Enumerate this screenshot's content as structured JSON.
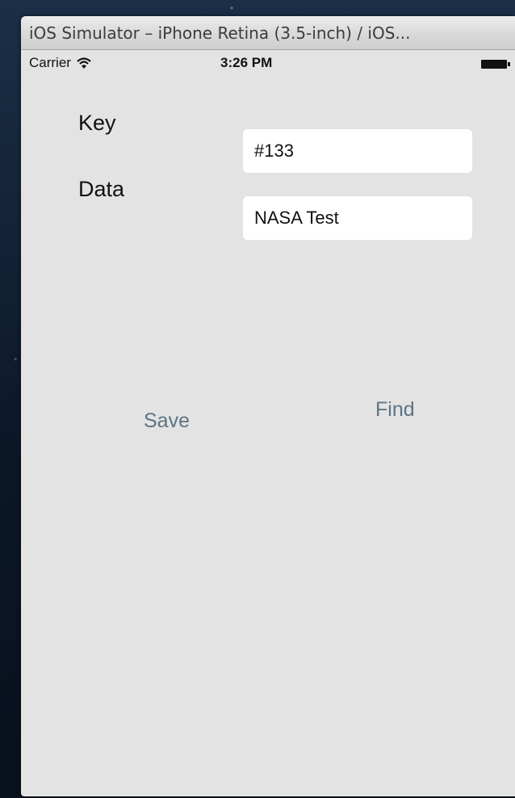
{
  "window": {
    "title": "iOS Simulator – iPhone Retina (3.5-inch) / iOS..."
  },
  "status_bar": {
    "carrier": "Carrier",
    "time": "3:26 PM",
    "icons": [
      "wifi-icon",
      "battery-icon"
    ]
  },
  "form": {
    "key_label": "Key",
    "key_value": "#133",
    "data_label": "Data",
    "data_value": "NASA Test"
  },
  "buttons": {
    "save": "Save",
    "find": "Find"
  },
  "colors": {
    "background": "#e3e3e3",
    "field": "#ffffff",
    "button_text": "#5d7585"
  }
}
